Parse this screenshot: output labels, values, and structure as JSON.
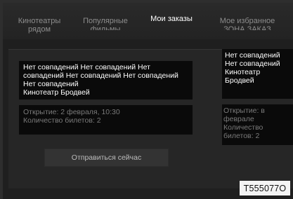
{
  "tabs": [
    {
      "label_line1": "Кинотеатры",
      "label_line2": "рядом",
      "active": false
    },
    {
      "label_line1": "Популярные",
      "label_line2": "фильмы",
      "active": false
    },
    {
      "label_line1": "Мои заказы",
      "label_line2": "",
      "active": true
    },
    {
      "label_line1": "Мое избранное",
      "label_line2": "ЗОНА ЗАКАЗ",
      "active": false
    }
  ],
  "order_main": {
    "movie_text": "Нет совпадений Нет совпадений Нет совпадений Нет совпадений Нет совпадений Нет совпадений",
    "theater": "Кинотеатр Бродвей",
    "opening": "Открытие: 2 февраля, 10:30",
    "tickets": "Количество билетов: 2"
  },
  "order_side": {
    "movie_text": "Нет совпадений Нет совпадений",
    "theater": "Кинотеатр Бродвей",
    "opening": "Открытие: в феврале",
    "tickets": "Количество билетов: 2"
  },
  "send_button": "Отправиться сейчас",
  "code": "T555077O"
}
